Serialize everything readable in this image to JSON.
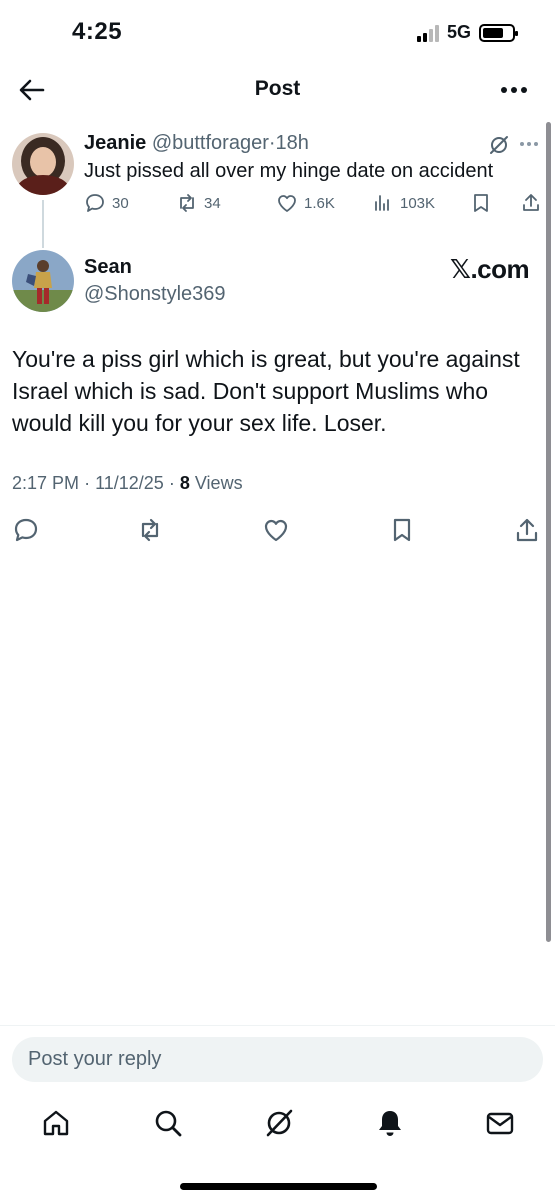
{
  "status_bar": {
    "time": "4:25",
    "network": "5G"
  },
  "header": {
    "title": "Post"
  },
  "parent_post": {
    "name": "Jeanie",
    "handle": "@buttforager",
    "separator": "·",
    "age": "18h",
    "text": "Just pissed all over my hinge date on accident",
    "replies": "30",
    "reposts": "34",
    "likes": "1.6K",
    "views": "103K"
  },
  "main_post": {
    "name": "Sean",
    "handle": "@Shonstyle369",
    "source_badge": "𝕏.com",
    "text": "You're a piss girl which is great, but you're against Israel which is sad. Don't support Muslims who would kill you for your sex life. Loser.",
    "time": "2:17 PM",
    "date": "11/12/25",
    "sep": "·",
    "view_count": "8",
    "views_label": "Views"
  },
  "reply": {
    "placeholder": "Post your reply"
  },
  "colors": {
    "text": "#0f1419",
    "secondary": "#536471",
    "surface": "#eff3f4"
  },
  "icons": [
    "back-arrow-icon",
    "more-icon",
    "grok-icon",
    "reply-icon",
    "repost-icon",
    "like-icon",
    "views-icon",
    "bookmark-icon",
    "share-icon",
    "home-icon",
    "search-icon",
    "notifications-icon",
    "messages-icon"
  ]
}
